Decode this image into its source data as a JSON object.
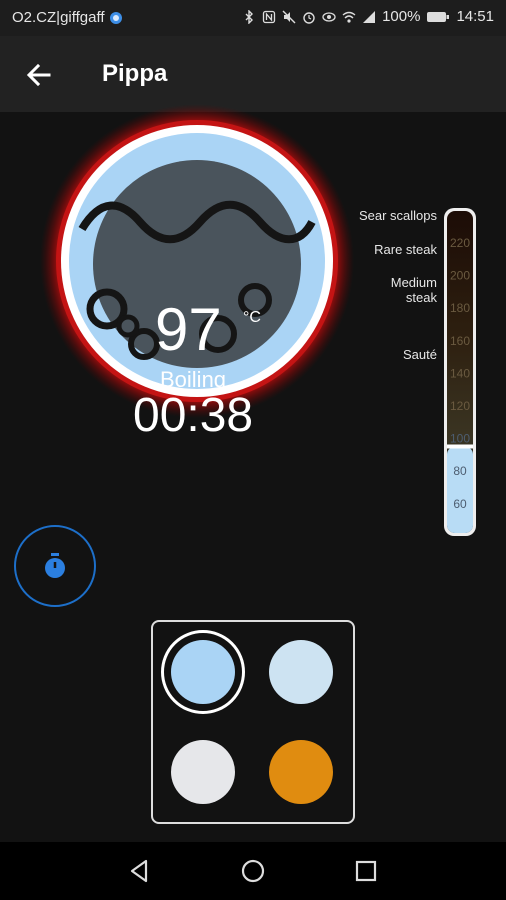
{
  "status_bar": {
    "carrier": "O2.CZ|giffgaff",
    "battery": "100%",
    "time": "14:51",
    "icons": [
      "bluetooth-icon",
      "nfc-icon",
      "mute-icon",
      "alarm-icon",
      "eye-icon",
      "wifi-icon",
      "signal-icon",
      "battery-icon"
    ]
  },
  "app_bar": {
    "title": "Pippa"
  },
  "dial": {
    "temperature": "97",
    "unit": "°C",
    "state": "Boiling",
    "time": "00:38",
    "colors": {
      "ring": "#d01010",
      "face": "#aad4f5",
      "inner": "#4a545c"
    }
  },
  "gauge": {
    "scale": [
      "220",
      "200",
      "180",
      "160",
      "140",
      "120",
      "100",
      "80",
      "60"
    ],
    "presets": [
      {
        "label": "Sear scallops"
      },
      {
        "label": "Rare steak"
      },
      {
        "label": "Medium steak"
      },
      {
        "label": "Sauté"
      }
    ],
    "current_level": 97
  },
  "palette": {
    "colors": [
      "#aad4f5",
      "#cde3f2",
      "#e6e7ea",
      "#e08c10"
    ],
    "selected_index": 0
  },
  "nav_bar": {
    "icons": [
      "back-icon",
      "home-icon",
      "recents-icon"
    ]
  }
}
